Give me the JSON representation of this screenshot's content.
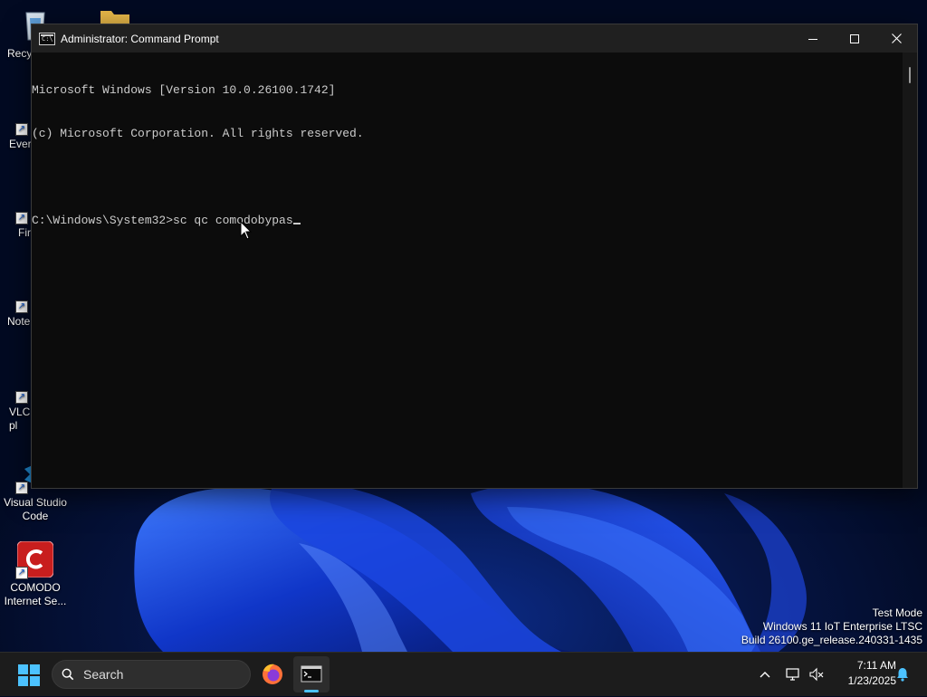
{
  "desktop": {
    "icons": [
      {
        "label": "Recy"
      },
      {
        "label": ""
      },
      {
        "label": "Ever"
      },
      {
        "label": "Fir"
      },
      {
        "label": "Note"
      },
      {
        "label": "VLC\npl"
      },
      {
        "label": "Visual Studio Code"
      },
      {
        "label": "COMODO Internet Se..."
      }
    ]
  },
  "window": {
    "title": "Administrator: Command Prompt",
    "icon": "cmd-icon",
    "lines": [
      "Microsoft Windows [Version 10.0.26100.1742]",
      "(c) Microsoft Corporation. All rights reserved.",
      "",
      "C:\\Windows\\System32>sc qc comodobypas"
    ]
  },
  "watermark": {
    "line1": "Test Mode",
    "line2": "Windows 11 IoT Enterprise LTSC",
    "line3": "Build 26100.ge_release.240331-1435"
  },
  "taskbar": {
    "search_placeholder": "Search",
    "apps": [
      "firefox-icon",
      "terminal-icon"
    ],
    "clock": {
      "time": "7:11 AM",
      "date": "1/23/2025"
    },
    "accent": "#4cc2ff"
  }
}
